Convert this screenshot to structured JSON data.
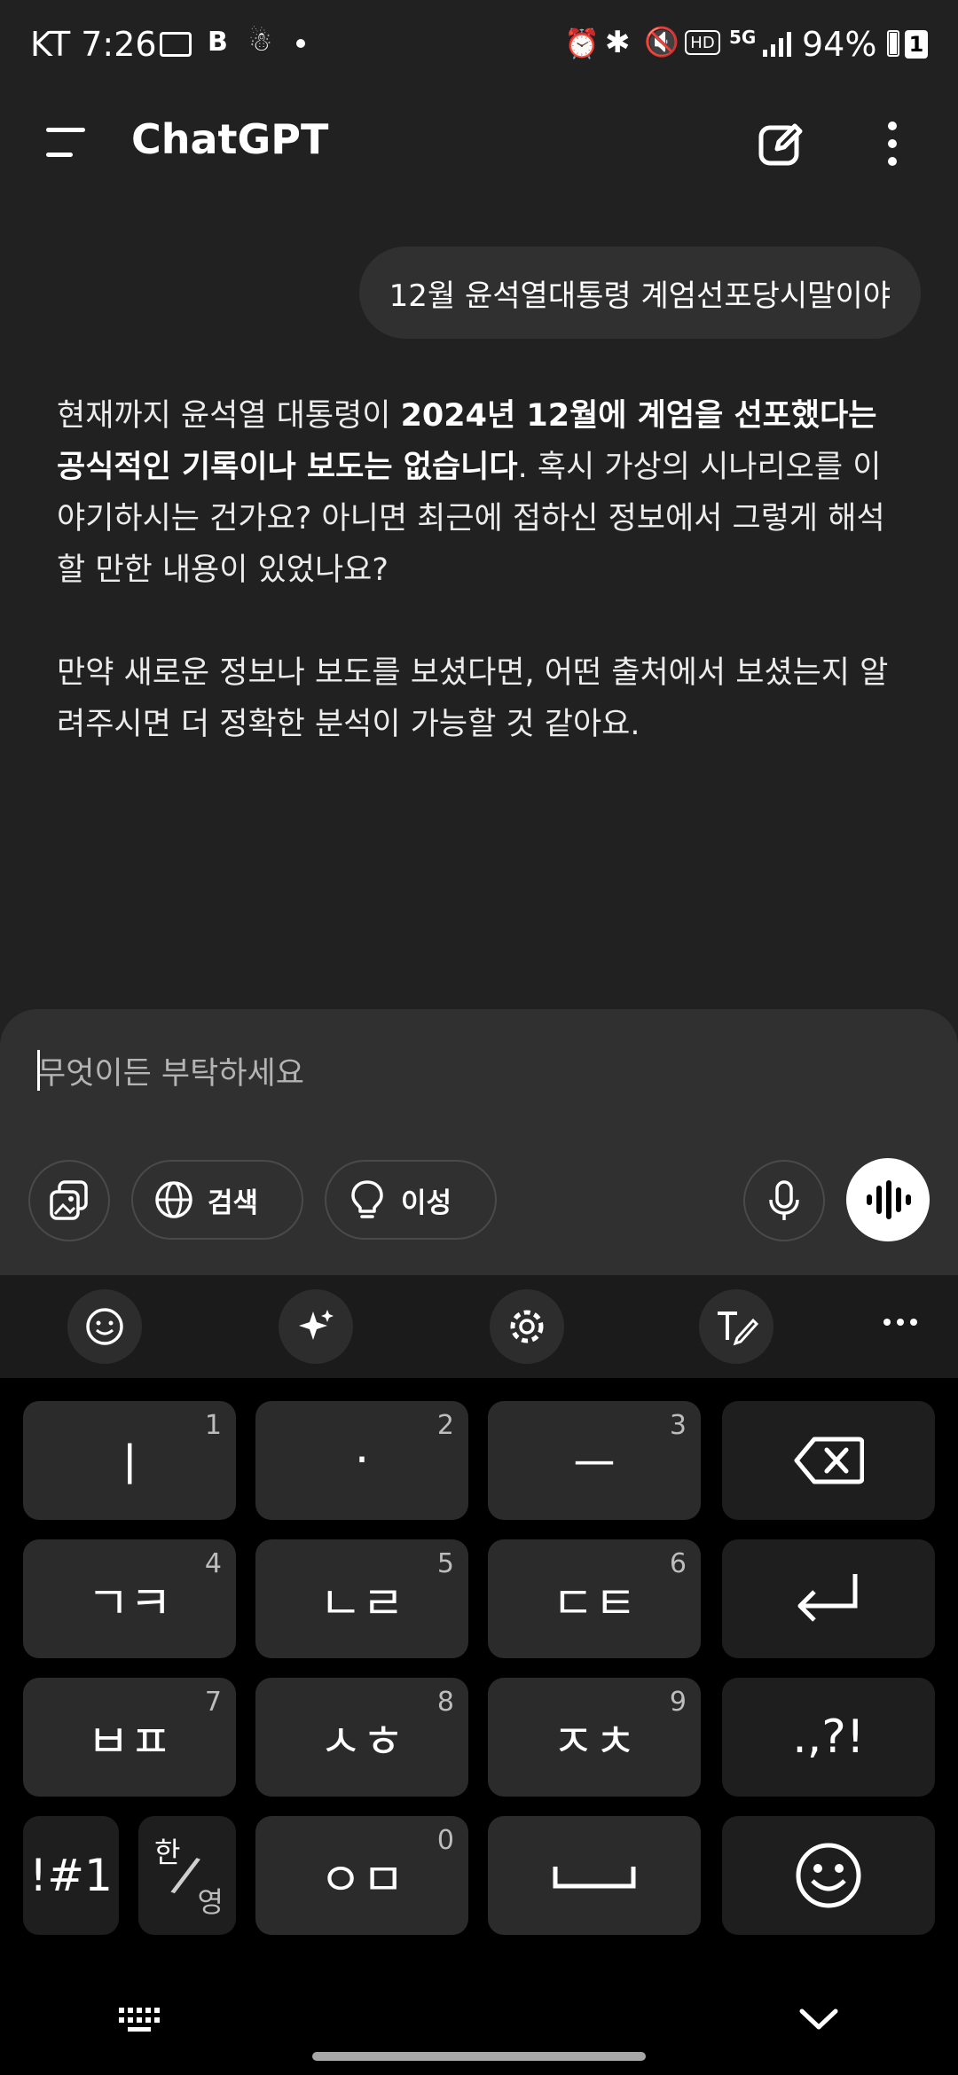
{
  "status_bar": {
    "carrier_time": "KT 7:26",
    "battery": "94%",
    "sim_badge": "1",
    "network": "5G"
  },
  "header": {
    "title": "ChatGPT",
    "menu_icon": "hamburger-icon",
    "new_chat_icon": "edit-icon",
    "more_icon": "more-vertical-icon"
  },
  "conversation": {
    "user_message": "12월 윤석열대통령 계엄선포당시말이야",
    "assistant": {
      "p1_a": "현재까지 윤석열 대통령이 ",
      "p1_b": "2024년 12월에 계엄을 선포했다는 공식적인 기록이나 보도는 없습니다",
      "p1_c": ". 혹시 가상의 시나리오를 이야기하시는 건가요? 아니면 최근에 접하신 정보에서 그렇게 해석할 만한 내용이 있었나요?",
      "p2": "만약 새로운 정보나 보도를 보셨다면, 어떤 출처에서 보셨는지 알려주시면 더 정확한 분석이 가능할 것 같아요."
    }
  },
  "composer": {
    "placeholder": "무엇이든 부탁하세요",
    "search_label": "검색",
    "reason_label": "이성"
  },
  "keyboard": {
    "rows": [
      [
        {
          "label": "ㅣ",
          "num": "1"
        },
        {
          "label": "·",
          "num": "2"
        },
        {
          "label": "ㅡ",
          "num": "3"
        }
      ],
      [
        {
          "label": "ㄱㅋ",
          "num": "4"
        },
        {
          "label": "ㄴㄹ",
          "num": "5"
        },
        {
          "label": "ㄷㅌ",
          "num": "6"
        }
      ],
      [
        {
          "label": "ㅂㅍ",
          "num": "7"
        },
        {
          "label": "ㅅㅎ",
          "num": "8"
        },
        {
          "label": "ㅈㅊ",
          "num": "9"
        }
      ]
    ],
    "punct_label": ".,?!",
    "symbols_label": "!#1",
    "lang_han": "한",
    "lang_eng": "영",
    "om_label": "ㅇㅁ",
    "om_num": "0"
  }
}
